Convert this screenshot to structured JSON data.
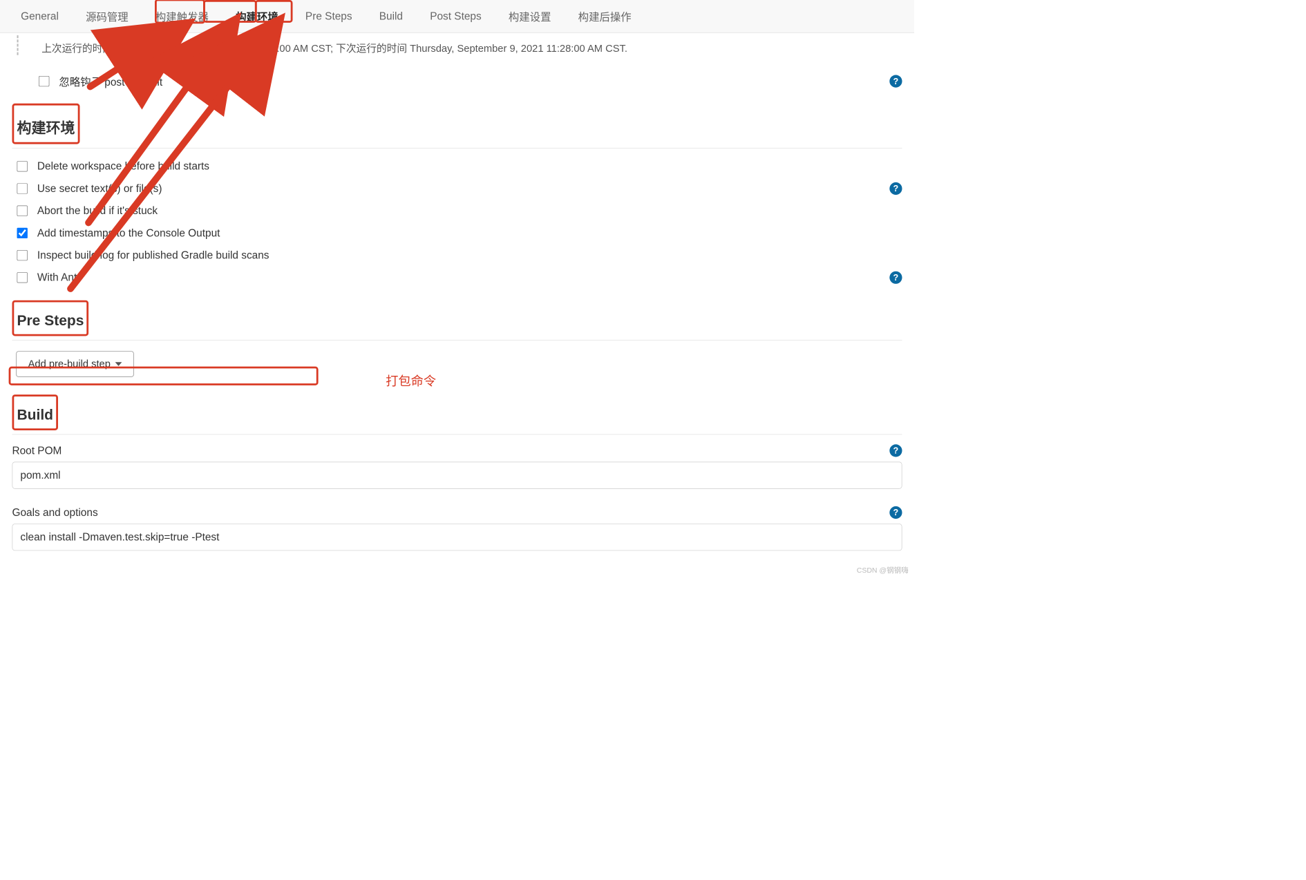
{
  "tabs": {
    "general": "General",
    "scm": "源码管理",
    "triggers": "构建触发器",
    "env": "构建环境",
    "pre": "Pre Steps",
    "build": "Build",
    "post": "Post Steps",
    "settings": "构建设置",
    "postbuild": "构建后操作"
  },
  "poll": {
    "schedule": "上次运行的时间 Thursday, September 9, 2021 11:18:00 AM CST; 下次运行的时间 Thursday, September 9, 2021 11:28:00 AM CST.",
    "ignore_hook": "忽略钩子 post-commit"
  },
  "sections": {
    "env_title": "构建环境",
    "pre_title": "Pre Steps",
    "build_title": "Build"
  },
  "env": {
    "delete_ws": "Delete workspace before build starts",
    "secret": "Use secret text(s) or file(s)",
    "abort": "Abort the build if it's stuck",
    "timestamps": "Add timestamps to the Console Output",
    "gradle": "Inspect build log for published Gradle build scans",
    "with_ant": "With Ant"
  },
  "pre": {
    "add_button": "Add pre-build step"
  },
  "build": {
    "root_pom_label": "Root POM",
    "root_pom_value": "pom.xml",
    "goals_label": "Goals and options",
    "goals_value": "clean install -Dmaven.test.skip=true -Ptest"
  },
  "annotation": {
    "package_cmd": "打包命令"
  },
  "help_icon": "?",
  "watermark": "CSDN @钢钢嗨"
}
